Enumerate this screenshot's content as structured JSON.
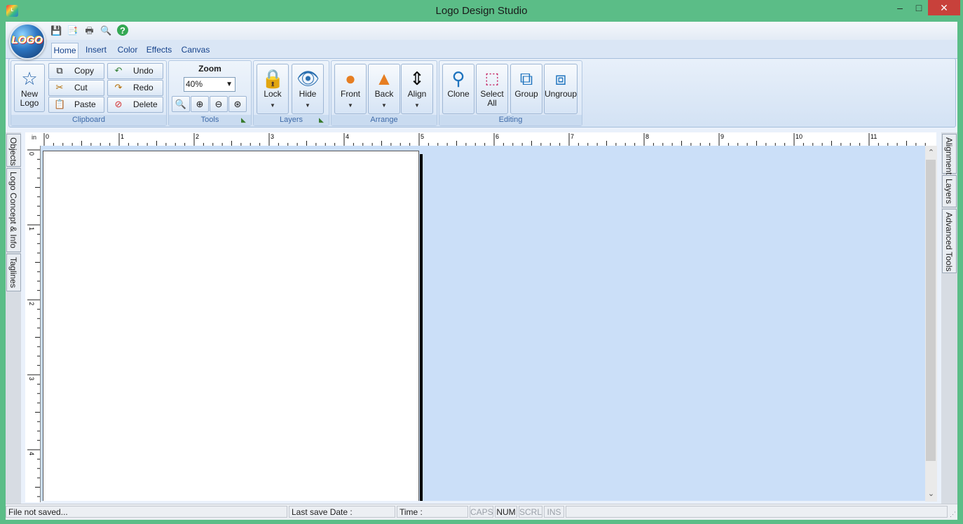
{
  "window": {
    "title": "Logo Design Studio",
    "minimize": "‒",
    "maximize": "□",
    "close": "✕"
  },
  "app_logo": {
    "text": "LOGO"
  },
  "quick_access": [
    {
      "icon": "save-icon",
      "glyph": "💾"
    },
    {
      "icon": "save-as-icon",
      "glyph": "📑"
    },
    {
      "icon": "print-icon",
      "glyph": "🖶"
    },
    {
      "icon": "print-preview-icon",
      "glyph": "🔍"
    },
    {
      "icon": "help-icon",
      "glyph": "?"
    }
  ],
  "tabs": [
    "Home",
    "Insert",
    "Color",
    "Effects",
    "Canvas"
  ],
  "ribbon": {
    "new_logo": {
      "line1": "New",
      "line2": "Logo"
    },
    "clipboard": {
      "label": "Clipboard",
      "copy": "Copy",
      "cut": "Cut",
      "paste": "Paste",
      "undo": "Undo",
      "redo": "Redo",
      "delete": "Delete"
    },
    "tools": {
      "label": "Tools",
      "zoom_label": "Zoom",
      "zoom_value": "40%"
    },
    "layers": {
      "label": "Layers",
      "lock": "Lock",
      "hide": "Hide"
    },
    "arrange": {
      "label": "Arrange",
      "front": "Front",
      "back": "Back",
      "align": "Align"
    },
    "editing": {
      "label": "Editing",
      "clone": "Clone",
      "select_all_1": "Select",
      "select_all_2": "All",
      "group": "Group",
      "ungroup": "Ungroup"
    }
  },
  "left_tabs": [
    "Objects",
    "Logo Concept & Info",
    "Taglines"
  ],
  "right_tabs": [
    "Alignment",
    "Layers",
    "Advanced Tools"
  ],
  "ruler": {
    "unit": "in",
    "h_labels": [
      "0",
      "1",
      "2",
      "3",
      "4",
      "5",
      "6",
      "7",
      "8",
      "9",
      "10",
      "11"
    ],
    "v_labels": [
      "0",
      "1",
      "2",
      "3",
      "4"
    ]
  },
  "status": {
    "file": "File not saved...",
    "last_save": "Last save Date :",
    "time": "Time :",
    "caps": "CAPS",
    "num": "NUM",
    "scrl": "SCRL",
    "ins": "INS"
  }
}
